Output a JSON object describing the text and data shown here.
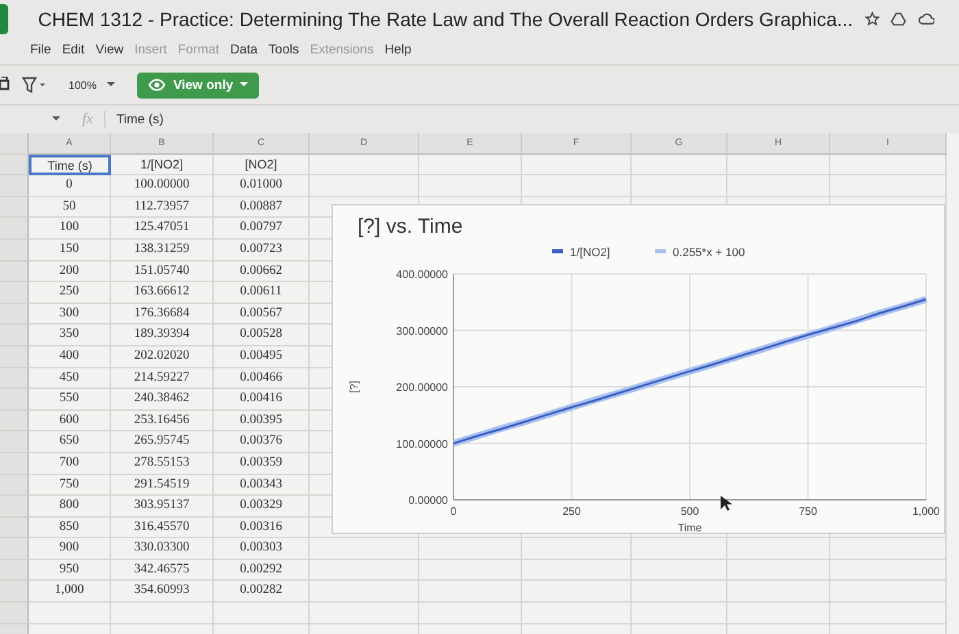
{
  "document": {
    "title": "CHEM 1312 - Practice: Determining The Rate Law  and The Overall Reaction Orders Graphica..."
  },
  "menu": [
    {
      "label": "File",
      "disabled": false
    },
    {
      "label": "Edit",
      "disabled": false
    },
    {
      "label": "View",
      "disabled": false
    },
    {
      "label": "Insert",
      "disabled": true
    },
    {
      "label": "Format",
      "disabled": true
    },
    {
      "label": "Data",
      "disabled": false
    },
    {
      "label": "Tools",
      "disabled": false
    },
    {
      "label": "Extensions",
      "disabled": true
    },
    {
      "label": "Help",
      "disabled": false
    }
  ],
  "toolbar": {
    "zoom": "100%",
    "mode_button": "View only"
  },
  "formula_bar": {
    "fx": "fx",
    "content": "Time (s)"
  },
  "columns": [
    "A",
    "B",
    "C",
    "D",
    "E",
    "F",
    "G",
    "H",
    "I"
  ],
  "header_row": [
    {
      "text": "Time (s)",
      "selected": true
    },
    {
      "text": "1/[NO2]",
      "selected": false
    },
    {
      "text": "[NO2]",
      "selected": false
    }
  ],
  "rows": [
    [
      "0",
      "100.00000",
      "0.01000"
    ],
    [
      "50",
      "112.73957",
      "0.00887"
    ],
    [
      "100",
      "125.47051",
      "0.00797"
    ],
    [
      "150",
      "138.31259",
      "0.00723"
    ],
    [
      "200",
      "151.05740",
      "0.00662"
    ],
    [
      "250",
      "163.66612",
      "0.00611"
    ],
    [
      "300",
      "176.36684",
      "0.00567"
    ],
    [
      "350",
      "189.39394",
      "0.00528"
    ],
    [
      "400",
      "202.02020",
      "0.00495"
    ],
    [
      "450",
      "214.59227",
      "0.00466"
    ],
    [
      "550",
      "240.38462",
      "0.00416"
    ],
    [
      "600",
      "253.16456",
      "0.00395"
    ],
    [
      "650",
      "265.95745",
      "0.00376"
    ],
    [
      "700",
      "278.55153",
      "0.00359"
    ],
    [
      "750",
      "291.54519",
      "0.00343"
    ],
    [
      "800",
      "303.95137",
      "0.00329"
    ],
    [
      "850",
      "316.45570",
      "0.00316"
    ],
    [
      "900",
      "330.03300",
      "0.00303"
    ],
    [
      "950",
      "342.46575",
      "0.00292"
    ],
    [
      "1,000",
      "354.60993",
      "0.00282"
    ]
  ],
  "chart": {
    "chart_data": {
      "type": "line",
      "title": "[?] vs. Time",
      "xlabel": "Time",
      "ylabel": "[?]",
      "x": [
        0,
        50,
        100,
        150,
        200,
        250,
        300,
        350,
        400,
        450,
        550,
        600,
        650,
        700,
        750,
        800,
        850,
        900,
        950,
        1000
      ],
      "series": [
        {
          "name": "1/[NO2]",
          "color": "#3d5fc4",
          "values": [
            100,
            113,
            125,
            138,
            151,
            164,
            176,
            189,
            202,
            215,
            240,
            253,
            266,
            279,
            292,
            304,
            316,
            330,
            342,
            355
          ]
        },
        {
          "name": "0.255*x + 100",
          "color": "#a9c1ee",
          "values": [
            100,
            113,
            126,
            138,
            151,
            164,
            177,
            189,
            202,
            215,
            240,
            253,
            266,
            279,
            291,
            304,
            317,
            330,
            342,
            355
          ]
        }
      ],
      "grid": true,
      "legend": true,
      "xlim": [
        0,
        1000
      ],
      "ylim": [
        0,
        400
      ],
      "xticks": [
        {
          "value": 0,
          "label": "0"
        },
        {
          "value": 250,
          "label": "250"
        },
        {
          "value": 500,
          "label": "500"
        },
        {
          "value": 750,
          "label": "750"
        },
        {
          "value": 1000,
          "label": "1,000"
        }
      ],
      "yticks": [
        {
          "value": 0,
          "label": "0.00000"
        },
        {
          "value": 100,
          "label": "100.00000"
        },
        {
          "value": 200,
          "label": "200.00000"
        },
        {
          "value": 300,
          "label": "300.00000"
        },
        {
          "value": 400,
          "label": "400.00000"
        }
      ]
    }
  }
}
